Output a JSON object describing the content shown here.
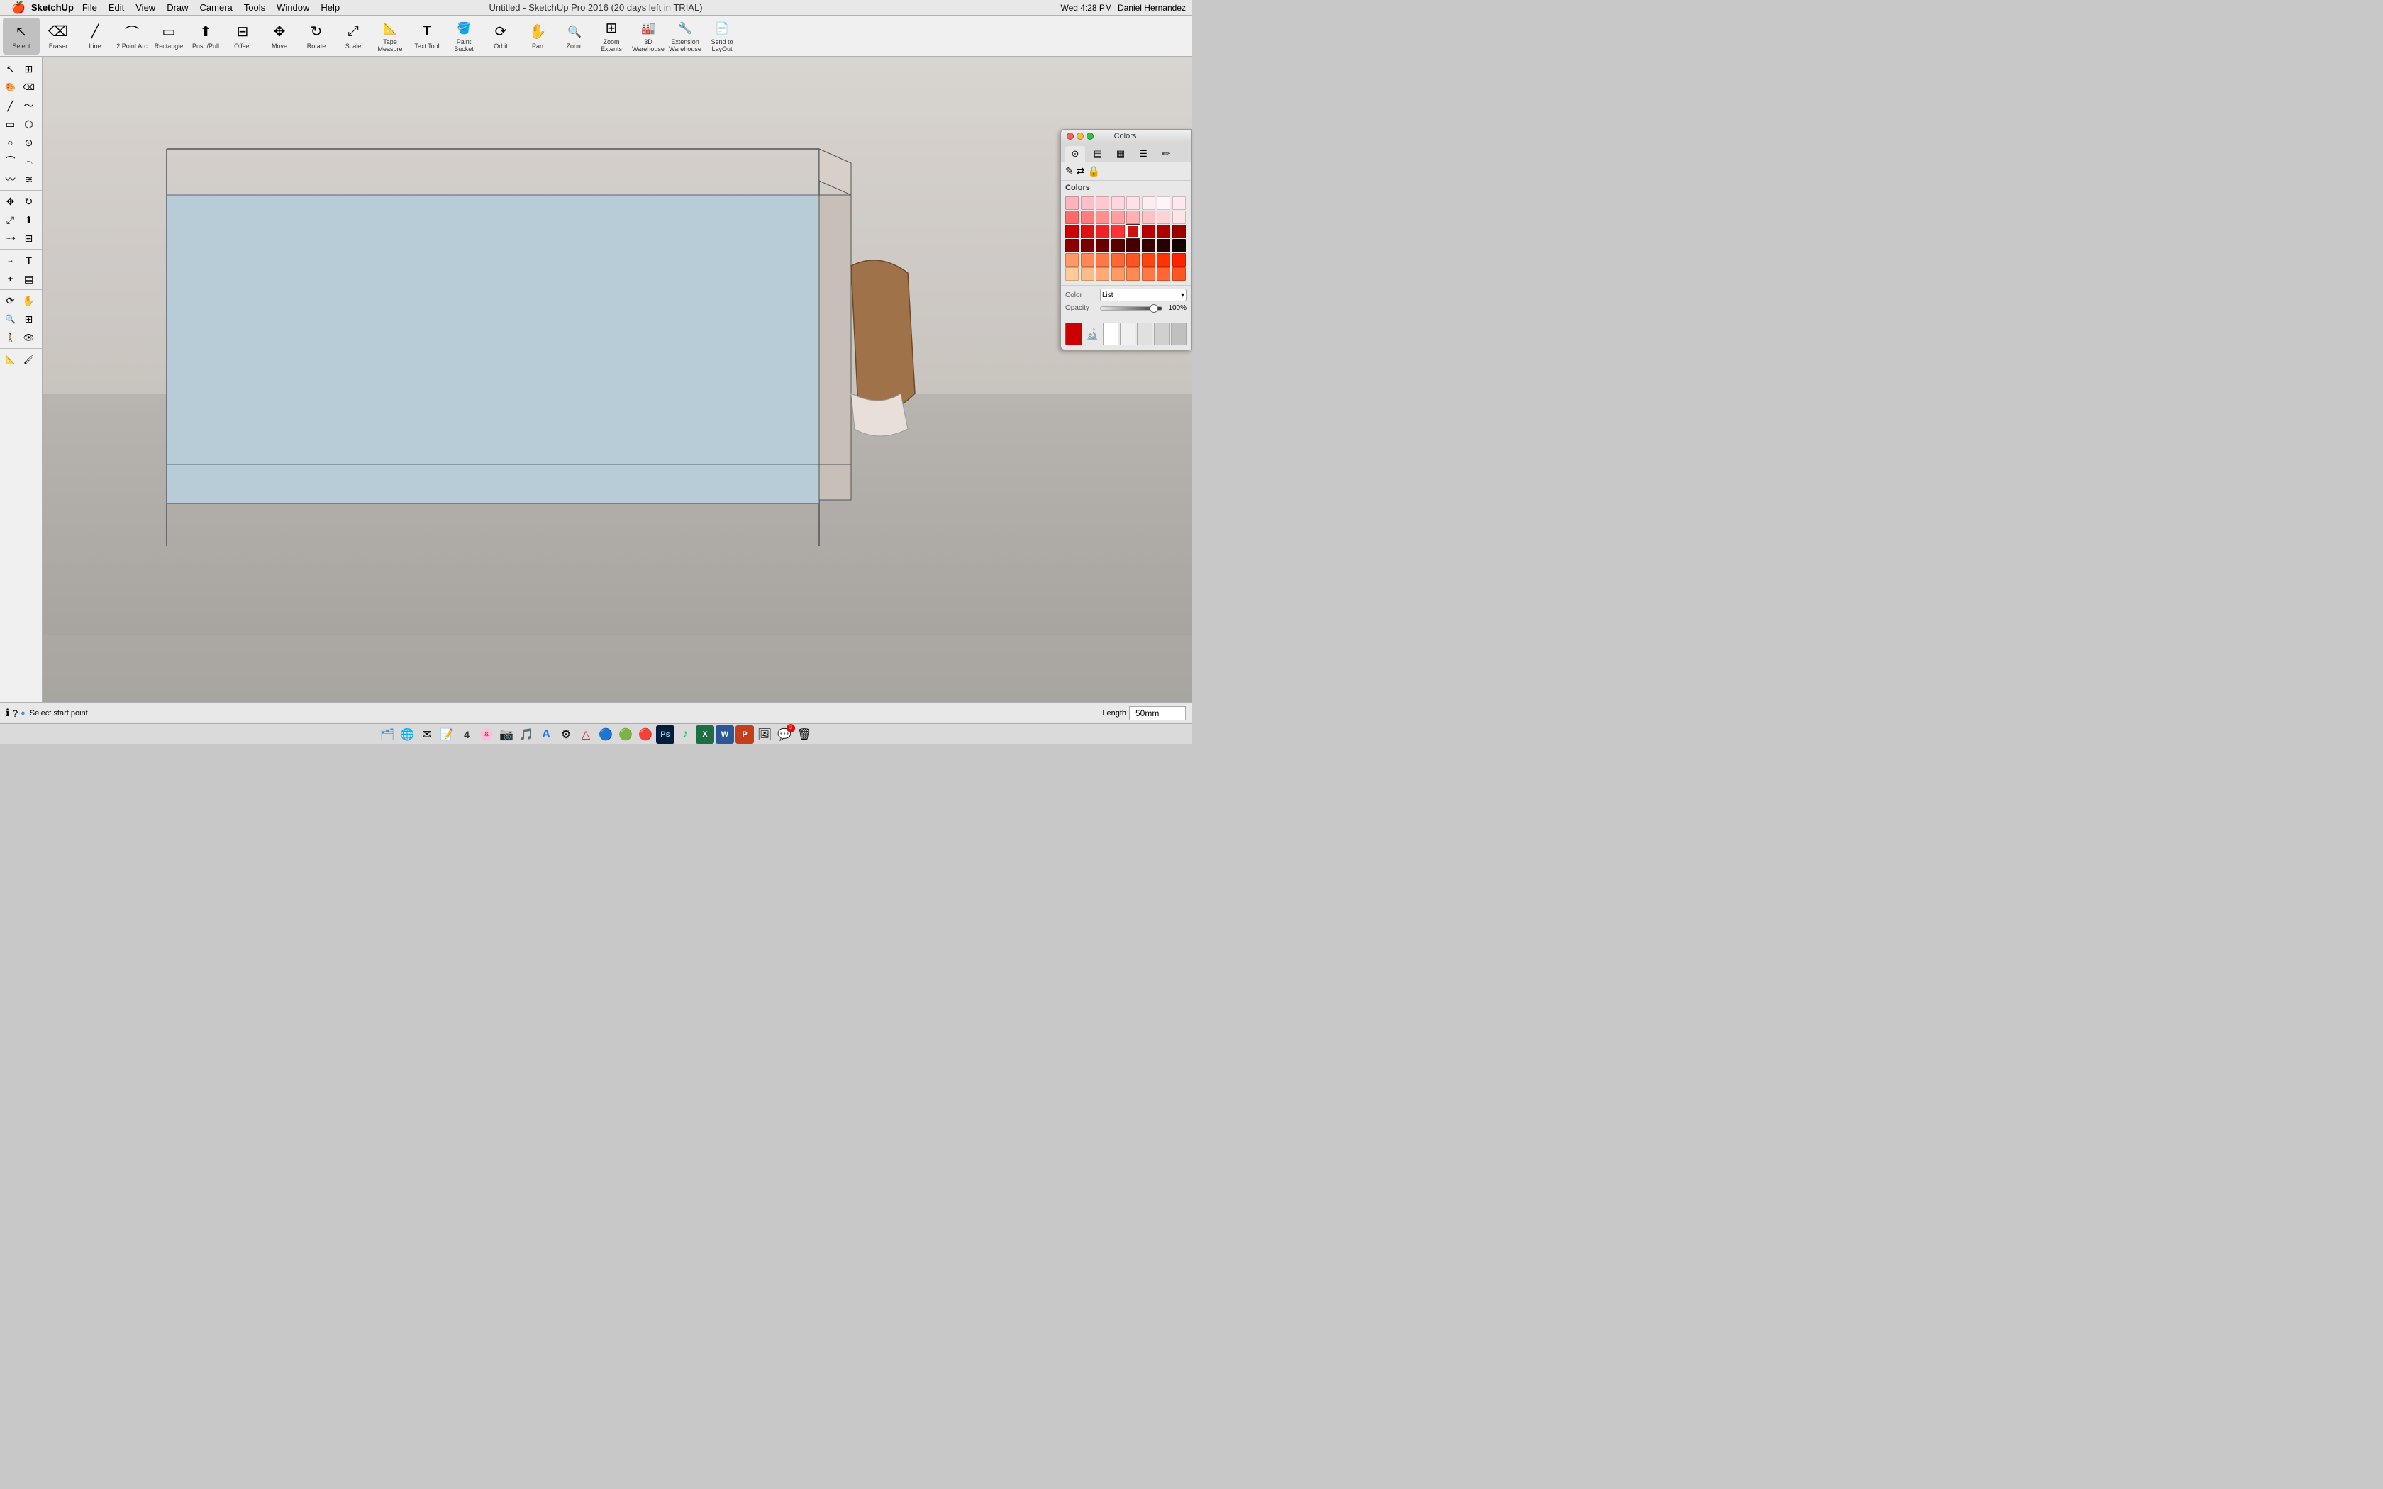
{
  "app": {
    "name": "SketchUp",
    "title": "Untitled - SketchUp Pro 2016 (20 days left in TRIAL)"
  },
  "menubar": {
    "apple": "🍎",
    "items": [
      "SketchUp",
      "File",
      "Edit",
      "View",
      "Draw",
      "Camera",
      "Tools",
      "Window",
      "Help"
    ],
    "right": {
      "time": "Wed 4:28 PM",
      "user": "Daniel Hernandez"
    }
  },
  "toolbar": {
    "tools": [
      {
        "id": "select",
        "label": "Select",
        "icon": "↖",
        "active": true
      },
      {
        "id": "eraser",
        "label": "Eraser",
        "icon": "⌫"
      },
      {
        "id": "line",
        "label": "Line",
        "icon": "╱"
      },
      {
        "id": "2pt-arc",
        "label": "2 Point Arc",
        "icon": "⌒"
      },
      {
        "id": "rectangle",
        "label": "Rectangle",
        "icon": "▭"
      },
      {
        "id": "push-pull",
        "label": "Push/Pull",
        "icon": "⬆"
      },
      {
        "id": "offset",
        "label": "Offset",
        "icon": "⊟"
      },
      {
        "id": "move",
        "label": "Move",
        "icon": "✥"
      },
      {
        "id": "rotate",
        "label": "Rotate",
        "icon": "↻"
      },
      {
        "id": "scale",
        "label": "Scale",
        "icon": "⤢"
      },
      {
        "id": "tape-measure",
        "label": "Tape Measure",
        "icon": "📐"
      },
      {
        "id": "text-tool",
        "label": "Text Tool",
        "icon": "T"
      },
      {
        "id": "paint-bucket",
        "label": "Paint Bucket",
        "icon": "🪣"
      },
      {
        "id": "orbit",
        "label": "Orbit",
        "icon": "⟳"
      },
      {
        "id": "pan",
        "label": "Pan",
        "icon": "✋"
      },
      {
        "id": "zoom",
        "label": "Zoom",
        "icon": "🔍"
      },
      {
        "id": "zoom-extents",
        "label": "Zoom Extents",
        "icon": "⊞"
      },
      {
        "id": "3d-warehouse",
        "label": "3D Warehouse",
        "icon": "🏭"
      },
      {
        "id": "extension-warehouse",
        "label": "Extension Warehouse",
        "icon": "🔧"
      },
      {
        "id": "send-to-layout",
        "label": "Send to LayOut",
        "icon": "📄"
      }
    ]
  },
  "sidebar": {
    "tools": [
      {
        "id": "select-top",
        "icon": "↖"
      },
      {
        "id": "select-bottom",
        "icon": "⊞"
      },
      {
        "id": "paint1",
        "icon": "🎨"
      },
      {
        "id": "paint2",
        "icon": "🖌"
      },
      {
        "id": "line1",
        "icon": "╱"
      },
      {
        "id": "line2",
        "icon": "〜"
      },
      {
        "id": "rect1",
        "icon": "▭"
      },
      {
        "id": "rect2",
        "icon": "⬡"
      },
      {
        "id": "circle1",
        "icon": "○"
      },
      {
        "id": "circle2",
        "icon": "⊙"
      },
      {
        "id": "arc1",
        "icon": "⌒"
      },
      {
        "id": "arc2",
        "icon": "⌓"
      },
      {
        "id": "freehand1",
        "icon": "〰"
      },
      {
        "id": "freehand2",
        "icon": "≋"
      },
      {
        "id": "move-s",
        "icon": "✥"
      },
      {
        "id": "rotate-s",
        "icon": "↻"
      },
      {
        "id": "scale-s",
        "icon": "⤢"
      },
      {
        "id": "pushpull-s",
        "icon": "⬆"
      },
      {
        "id": "followme-s",
        "icon": "⟿"
      },
      {
        "id": "offset-s",
        "icon": "⊟"
      },
      {
        "id": "dim-s",
        "icon": "↔"
      },
      {
        "id": "text-s",
        "icon": "T"
      },
      {
        "id": "axes-s",
        "icon": "+"
      },
      {
        "id": "section-s",
        "icon": "▤"
      },
      {
        "id": "orbit-s",
        "icon": "⟳"
      },
      {
        "id": "pan-s",
        "icon": "✋"
      },
      {
        "id": "zoom-s",
        "icon": "🔍"
      },
      {
        "id": "zoomext-s",
        "icon": "⊞"
      },
      {
        "id": "walk-s",
        "icon": "🚶"
      },
      {
        "id": "look-s",
        "icon": "👁"
      },
      {
        "id": "measure-s",
        "icon": "📐"
      },
      {
        "id": "paint-s",
        "icon": "🖌"
      }
    ]
  },
  "colors_panel": {
    "title": "Colors",
    "tabs": [
      {
        "id": "wheel",
        "icon": "⊙",
        "label": "Color Wheel"
      },
      {
        "id": "sliders",
        "icon": "▤",
        "label": "Sliders"
      },
      {
        "id": "palette",
        "icon": "▦",
        "label": "Palette"
      },
      {
        "id": "list",
        "icon": "☰",
        "label": "List"
      },
      {
        "id": "crayon",
        "icon": "✏",
        "label": "Crayons"
      }
    ],
    "toolbar_icons": [
      {
        "id": "pencil-icon",
        "icon": "✎"
      },
      {
        "id": "flip-icon",
        "icon": "⇄"
      },
      {
        "id": "lock-icon",
        "icon": "🔒"
      }
    ],
    "header": "Colors",
    "swatches": [
      [
        "#ffb3ba",
        "#ffbac7",
        "#ffc8d0",
        "#ffd5de",
        "#ffe0e8",
        "#ffebf0",
        "#fff5f8",
        "#ffe8f0"
      ],
      [
        "#ff6b6b",
        "#ff7c7c",
        "#ff8e8e",
        "#ff9f9f",
        "#ffb0b0",
        "#ffc2c2",
        "#ffd3d3",
        "#ffe4e4"
      ],
      [
        "#cc0000",
        "#dd1111",
        "#ee2222",
        "#ff3333",
        "#cc1111",
        "#bb0000",
        "#aa0000",
        "#990000"
      ],
      [
        "#8b0000",
        "#7a0000",
        "#690000",
        "#580000",
        "#470000",
        "#360000",
        "#250000",
        "#140000"
      ],
      [
        "#ff9966",
        "#ff8855",
        "#ff7744",
        "#ff6633",
        "#ff5522",
        "#ff4411",
        "#ff3300",
        "#ff2200"
      ],
      [
        "#ffcc99",
        "#ffbb88",
        "#ffaa77",
        "#ff9966",
        "#ff8855",
        "#ff7744",
        "#ff6633",
        "#ff5522"
      ]
    ],
    "color_label": "Color",
    "color_dropdown": "List",
    "opacity_label": "Opacity",
    "opacity_value": "100%",
    "selected_color": "#cc0000"
  },
  "statusbar": {
    "status_icon_info": "ℹ",
    "status_icon_question": "?",
    "status_icon_dot": "●",
    "status_text": "Select start point",
    "length_label": "Length",
    "length_value": "50mm"
  },
  "dock": {
    "items": [
      {
        "id": "finder",
        "icon": "🗂",
        "label": "Finder"
      },
      {
        "id": "safari",
        "icon": "🌐",
        "label": "Safari"
      },
      {
        "id": "mail",
        "icon": "✉",
        "label": "Mail"
      },
      {
        "id": "notes",
        "icon": "📝",
        "label": "Notes"
      },
      {
        "id": "calendar",
        "icon": "📅",
        "label": "Calendar"
      },
      {
        "id": "photos",
        "icon": "🌸",
        "label": "Photos"
      },
      {
        "id": "image-capture",
        "icon": "📷",
        "label": "Image Capture"
      },
      {
        "id": "itunes",
        "icon": "🎵",
        "label": "iTunes"
      },
      {
        "id": "appstore",
        "icon": "🅰",
        "label": "App Store"
      },
      {
        "id": "prefs",
        "icon": "⚙",
        "label": "System Prefs"
      },
      {
        "id": "artstudio",
        "icon": "△",
        "label": "Art Studio"
      },
      {
        "id": "chrome",
        "icon": "🔵",
        "label": "Chrome"
      },
      {
        "id": "sketchup",
        "icon": "🟢",
        "label": "SketchUp"
      },
      {
        "id": "artrage",
        "icon": "🔴",
        "label": "ArtRage"
      },
      {
        "id": "photoshop",
        "icon": "Ps",
        "label": "Photoshop"
      },
      {
        "id": "excel",
        "icon": "X",
        "label": "Excel"
      },
      {
        "id": "word",
        "icon": "W",
        "label": "Word"
      },
      {
        "id": "pp",
        "icon": "P",
        "label": "PowerPoint"
      },
      {
        "id": "preview",
        "icon": "🖼",
        "label": "Preview"
      },
      {
        "id": "whatsapp",
        "icon": "💬",
        "label": "WhatsApp",
        "badge": "3"
      },
      {
        "id": "trash",
        "icon": "🗑",
        "label": "Trash"
      }
    ]
  }
}
